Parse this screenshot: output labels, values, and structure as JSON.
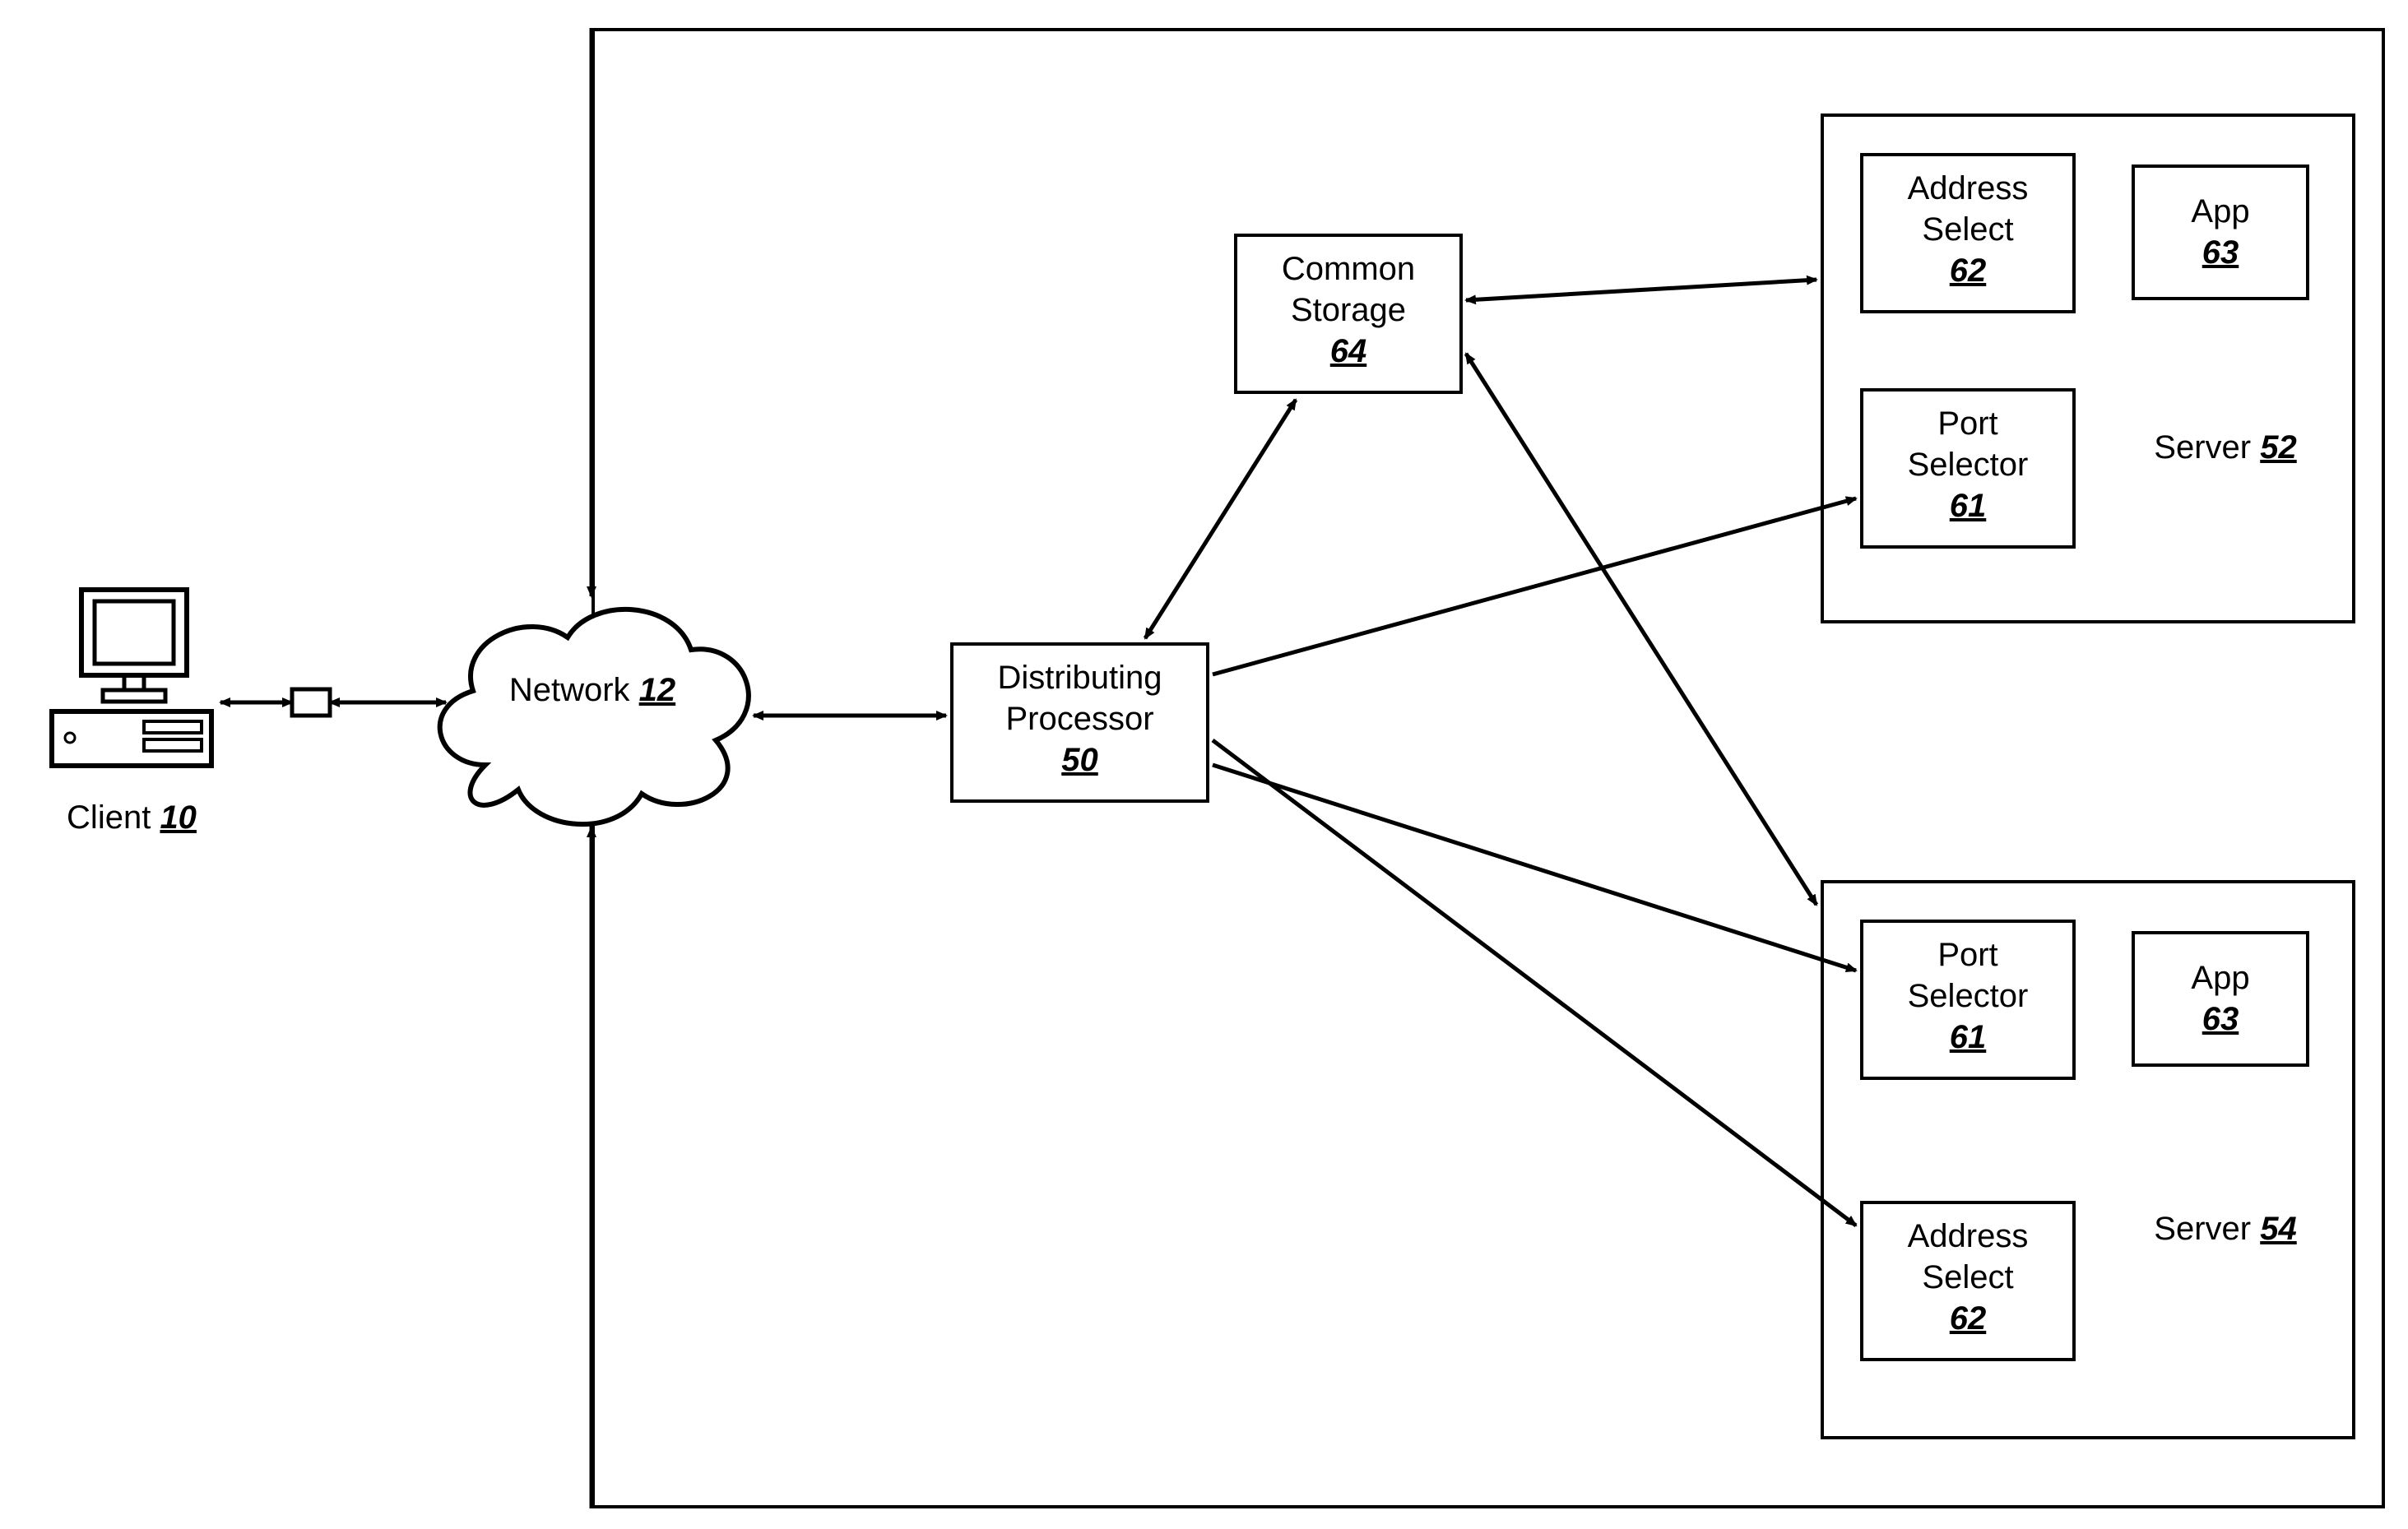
{
  "client": {
    "label": "Client",
    "num": "10"
  },
  "network": {
    "label": "Network",
    "num": "12"
  },
  "distributing": {
    "line1": "Distributing",
    "line2": "Processor",
    "num": "50"
  },
  "commonStorage": {
    "line1": "Common",
    "line2": "Storage",
    "num": "64"
  },
  "server1": {
    "label": "Server",
    "num": "52",
    "addrSelect": {
      "line1": "Address",
      "line2": "Select",
      "num": "62"
    },
    "app": {
      "label": "App",
      "num": "63"
    },
    "portSelector": {
      "line1": "Port",
      "line2": "Selector",
      "num": "61"
    }
  },
  "server2": {
    "label": "Server",
    "num": "54",
    "portSelector": {
      "line1": "Port",
      "line2": "Selector",
      "num": "61"
    },
    "app": {
      "label": "App",
      "num": "63"
    },
    "addrSelect": {
      "line1": "Address",
      "line2": "Select",
      "num": "62"
    }
  }
}
